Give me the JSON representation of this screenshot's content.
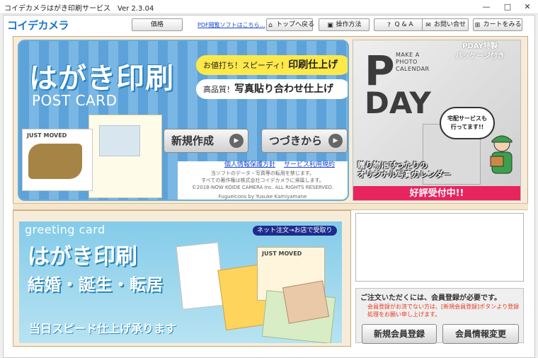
{
  "window": {
    "title": "コイデカメラはがき印刷サービス　Ver 2.3.04",
    "controls": {
      "minimize": "—",
      "maximize": "□",
      "close": "✕"
    }
  },
  "toolbar": {
    "logo": "コイデカメラ",
    "price_label": "価格",
    "pdf_link": "PDF閲覧ソフトはこちら…",
    "top_label": "トップへ戻る",
    "howto_label": "操作方法",
    "qa_label": "Q & A",
    "contact_label": "お問い合せ",
    "cart_label": "カートをみる",
    "icons": {
      "top": "home-icon",
      "howto": "book-icon",
      "qa": "question-icon",
      "contact": "mail-icon",
      "cart": "cart-icon"
    }
  },
  "hero": {
    "title": "はがき印刷",
    "subtitle": "POST CARD",
    "pill1_prefix": "お値打ち！スピーディ！",
    "pill1_bold": "印刷仕上げ",
    "pill2_prefix": "高品質！",
    "pill2_bold": "写真貼り合わせ仕上げ",
    "card_text": "JUST MOVED",
    "new_button": "新規作成",
    "continue_button": "つづきから",
    "privacy_link": "個人情報保護方針",
    "terms_link": "サービス利用規約",
    "notice1": "当ソフトのデータ・写真等の転用を禁じます。",
    "notice2": "すべての著作権は株式会社コイデカメラに帰属します。",
    "copyright": "©2018-NOW KOIDE CAMERA Inc. ALL RIGHTS RESERVED.",
    "icons_credit": "FugueIcons by Yusuke Kamiyamane"
  },
  "pday": {
    "p": "P",
    "day": "DAY",
    "make_line1": "MAKE A",
    "make_line2": "PHOTO",
    "make_line3": "CALENDAR",
    "package_line1": "PDAY特製",
    "package_line2": "パッケージ付き",
    "bubble_line1": "宅配サービスも",
    "bubble_line2": "行ってます!!",
    "caption_line1": "贈り物にぴったりの",
    "caption_line2": "オリジナル写真カレンダー",
    "banner": "好評受付中!!"
  },
  "greeting": {
    "label": "greeting card",
    "title": "はがき印刷",
    "subtitle": "結婚・誕生・転居",
    "badge": "ネット注文→お店で受取り",
    "speed": "当日スピード仕上げ承ります",
    "card_text": "JUST MOVED"
  },
  "member": {
    "heading": "ご注文いただくには、会員登録が必要です。",
    "note": "会員登録がお済でない方は、[新規会員登録]ボタンより登録処理をお願い申し上げます。",
    "register_button": "新規会員登録",
    "change_button": "会員情報変更"
  }
}
